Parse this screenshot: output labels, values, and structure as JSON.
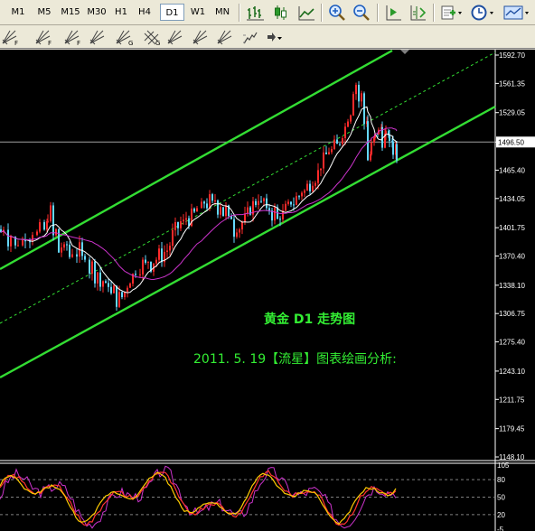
{
  "toolbar": {
    "timeframes": [
      "M1",
      "M5",
      "M15",
      "M30",
      "H1",
      "H4",
      "D1",
      "W1",
      "MN"
    ],
    "active_timeframe": "D1",
    "icons": [
      "bar-chart-icon",
      "candlestick-icon",
      "line-chart-icon",
      "zoom-in-icon",
      "zoom-out-icon",
      "autoscroll-icon",
      "chart-shift-icon",
      "indicators-icon",
      "periodicity-icon",
      "templates-icon"
    ]
  },
  "drawing_toolbar": {
    "icons": [
      "fibo-retracement-icon",
      "fibo-time-zones-icon",
      "fibo-fan-icon",
      "fibo-arcs-icon",
      "fibo-channel-icon",
      "gann-grid-icon",
      "gann-line-icon",
      "gann-fan-icon",
      "andrews-pitchfork-icon",
      "cycle-lines-icon",
      "arrows-icon"
    ]
  },
  "chart": {
    "title_line": "黄金  D1  走势图",
    "subtitle_line": "2011. 5. 19【流星】图表绘画分析:",
    "current_price": "1496.50",
    "price_axis": [
      "1592.70",
      "1561.35",
      "1529.05",
      "1496.50",
      "1465.40",
      "1434.05",
      "1401.75",
      "1370.40",
      "1338.10",
      "1306.75",
      "1275.40",
      "1243.10",
      "1211.75",
      "1179.45",
      "1148.10"
    ],
    "oscillator_axis": [
      "105",
      "80",
      "50",
      "20",
      "-5"
    ],
    "colors": {
      "background": "#000000",
      "up_candle": "#ff2a2a",
      "down_candle": "#66d9ff",
      "channel": "#33dd33",
      "ma_fast": "#ffffff",
      "ma_slow": "#cc33cc",
      "annotation": "#33ee33",
      "osc_main": "#ff3333",
      "osc_signal": "#ffcc00",
      "osc_third": "#cc33cc"
    }
  }
}
